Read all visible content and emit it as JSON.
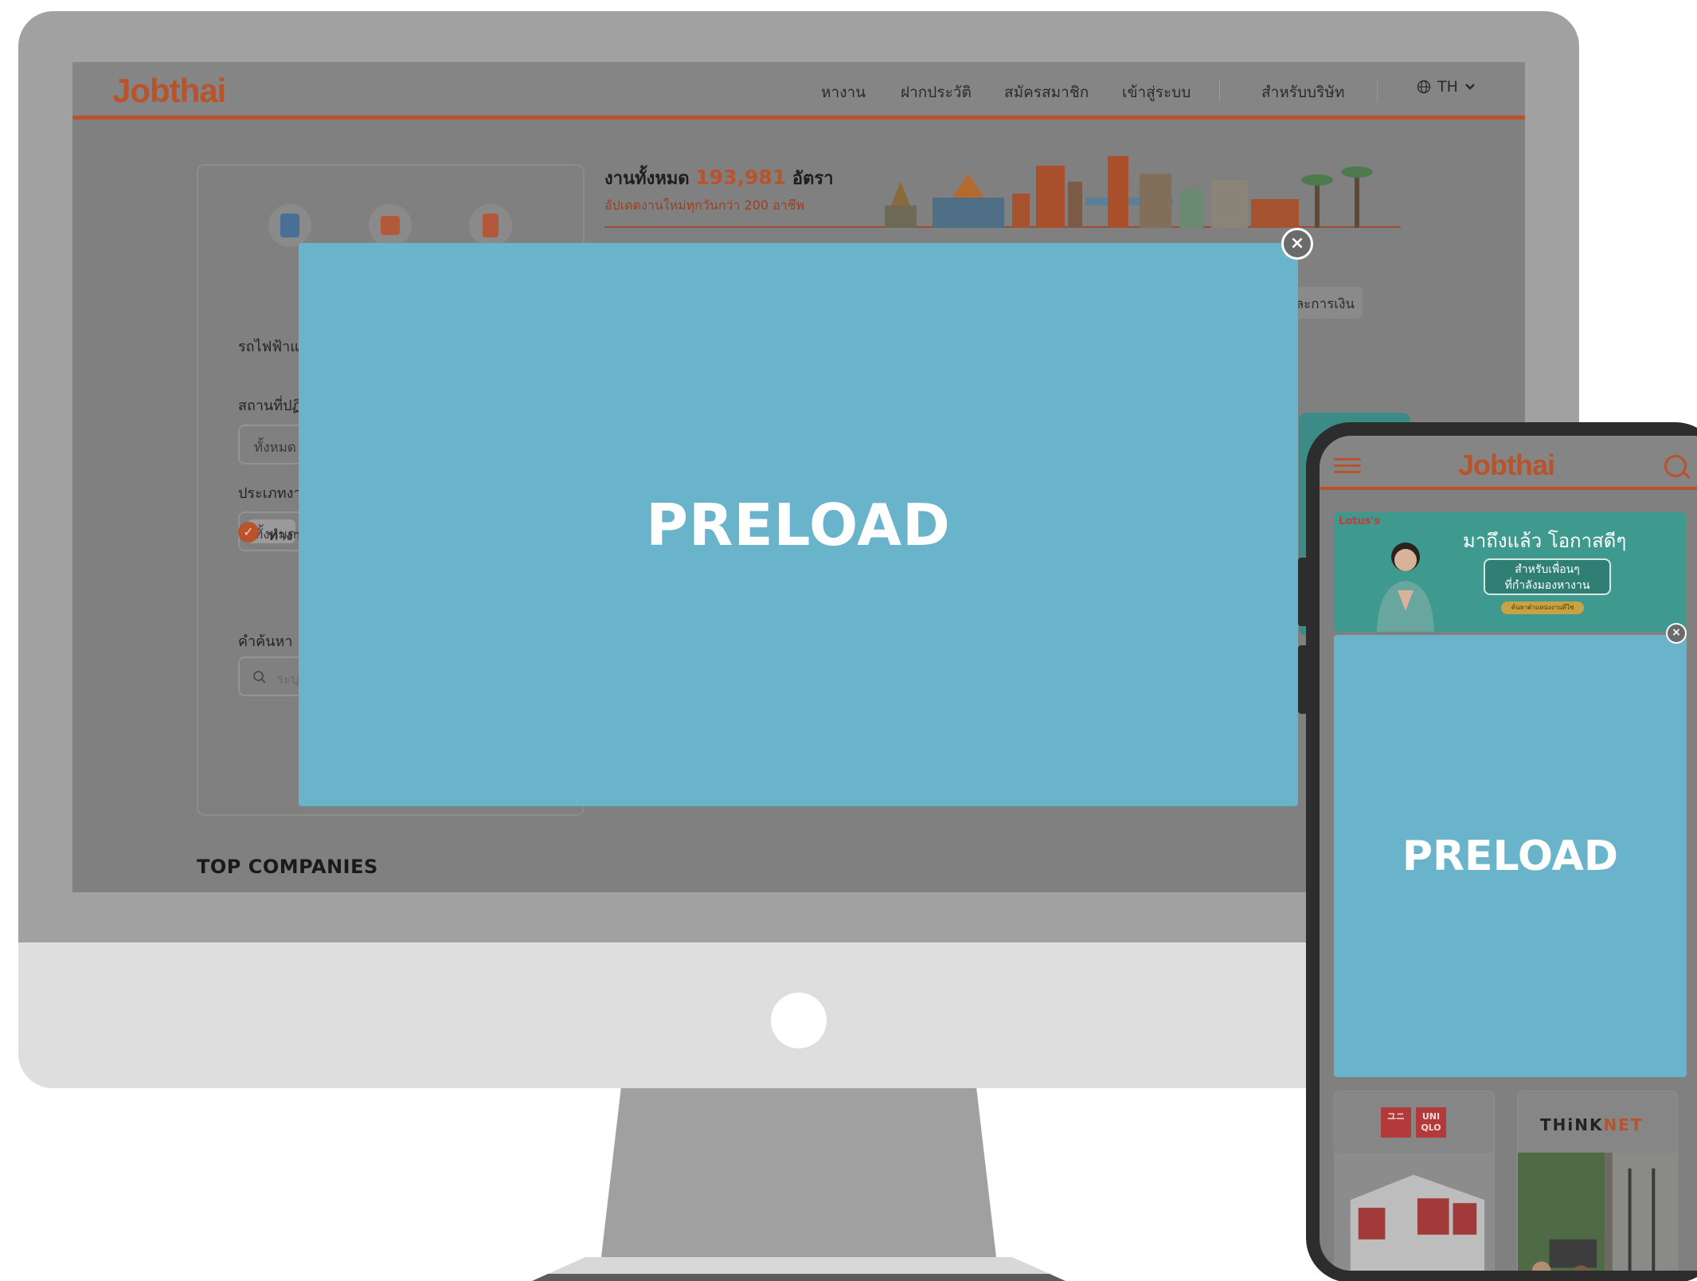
{
  "desktop": {
    "header": {
      "logo": "Jobthai",
      "nav": [
        "หางาน",
        "ฝากประวัติ",
        "สมัครสมาชิก",
        "เข้าสู่ระบบ",
        "สำหรับบริษัท"
      ],
      "language": "TH"
    },
    "search_card": {
      "category_label": "รถไฟฟ้าแล",
      "location_label": "สถานที่ปฏิ",
      "location_value": "ทั้งหมด",
      "job_type_label": "ประเภทงาน",
      "job_type_value": "ทั้งหมด",
      "checkbox_label": "ทำงา",
      "keyword_label": "คำค้นหา",
      "keyword_placeholder": "ระบุ"
    },
    "banner": {
      "total_prefix": "งานทั้งหมด",
      "total_count": "193,981",
      "total_suffix": "อัตรา",
      "subtitle": "อัปเดตงานใหม่ทุกวันกว่า 200 อาชีพ",
      "category_chip": "ละการเงิน"
    },
    "top_companies_title": "TOP COMPANIES",
    "modal": {
      "text": "PRELOAD",
      "close_label": "×"
    }
  },
  "mobile": {
    "header": {
      "logo": "Jobthai"
    },
    "banner": {
      "brand": "Lotus's",
      "title": "มาถึงแล้ว โอกาสดีๆ",
      "box_line1": "สำหรับเพื่อนๆ",
      "box_line2": "ที่กำลังมองหางาน",
      "pill": "ค้นหาตำแหน่งงานที่ใช่"
    },
    "modal": {
      "text": "PRELOAD",
      "close_label": "×"
    },
    "companies": [
      {
        "logo_top": "ユニ",
        "logo_bottom": "UNI QLO"
      },
      {
        "logo_a": "THiNK",
        "logo_b": "NET"
      }
    ]
  },
  "colors": {
    "brand": "#b8532c",
    "modal": "#69b3cb",
    "overlay": "#808080"
  }
}
